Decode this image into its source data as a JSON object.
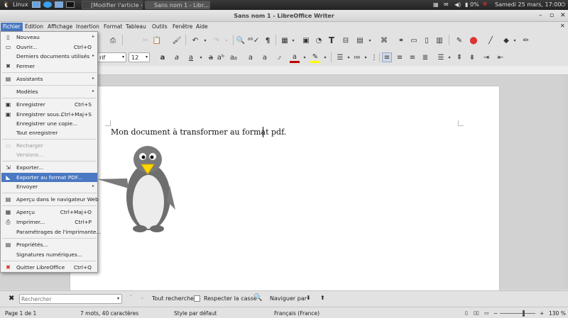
{
  "taskbar": {
    "os_label": "Linux",
    "tasks": [
      "[Modifier l'article <...",
      "Sans nom 1 - Libr..."
    ],
    "battery": "0%",
    "datetime": "Samedi 25 mars, 17:00"
  },
  "window": {
    "title": "Sans nom 1 - LibreOffice Writer"
  },
  "menubar": [
    "Fichier",
    "Édition",
    "Affichage",
    "Insertion",
    "Format",
    "Tableau",
    "Outils",
    "Fenêtre",
    "Aide"
  ],
  "format_bar": {
    "font_name": "rif",
    "font_size": "12"
  },
  "document": {
    "text": "Mon document à transformer au format pdf."
  },
  "file_menu": [
    {
      "label": "Nouveau",
      "shortcut": "",
      "submenu": true,
      "icon": "new-doc-icon",
      "disabled": false
    },
    {
      "label": "Ouvrir...",
      "shortcut": "Ctrl+O",
      "submenu": false,
      "icon": "open-folder-icon",
      "disabled": false
    },
    {
      "label": "Derniers documents utilisés",
      "shortcut": "",
      "submenu": true,
      "icon": "",
      "disabled": false
    },
    {
      "label": "Fermer",
      "shortcut": "",
      "submenu": false,
      "icon": "close-x-icon",
      "disabled": false
    },
    {
      "label": "Assistants",
      "shortcut": "",
      "submenu": true,
      "icon": "wizard-icon",
      "disabled": false
    },
    {
      "label": "Modèles",
      "shortcut": "",
      "submenu": true,
      "icon": "",
      "disabled": false
    },
    {
      "label": "Enregistrer",
      "shortcut": "Ctrl+S",
      "submenu": false,
      "icon": "save-icon",
      "disabled": false
    },
    {
      "label": "Enregistrer sous...",
      "shortcut": "Ctrl+Maj+S",
      "submenu": false,
      "icon": "save-as-icon",
      "disabled": false
    },
    {
      "label": "Enregistrer une copie...",
      "shortcut": "",
      "submenu": false,
      "icon": "",
      "disabled": false
    },
    {
      "label": "Tout enregistrer",
      "shortcut": "",
      "submenu": false,
      "icon": "",
      "disabled": false
    },
    {
      "label": "Recharger",
      "shortcut": "",
      "submenu": false,
      "icon": "reload-icon",
      "disabled": true
    },
    {
      "label": "Versions...",
      "shortcut": "",
      "submenu": false,
      "icon": "",
      "disabled": true
    },
    {
      "label": "Exporter...",
      "shortcut": "",
      "submenu": false,
      "icon": "export-icon",
      "disabled": false
    },
    {
      "label": "Exporter au format PDF...",
      "shortcut": "",
      "submenu": false,
      "icon": "pdf-icon",
      "disabled": false
    },
    {
      "label": "Envoyer",
      "shortcut": "",
      "submenu": true,
      "icon": "",
      "disabled": false
    },
    {
      "label": "Aperçu dans le navigateur Web",
      "shortcut": "",
      "submenu": false,
      "icon": "web-preview-icon",
      "disabled": false
    },
    {
      "label": "Aperçu",
      "shortcut": "Ctrl+Maj+O",
      "submenu": false,
      "icon": "print-preview-icon",
      "disabled": false
    },
    {
      "label": "Imprimer...",
      "shortcut": "Ctrl+P",
      "submenu": false,
      "icon": "print-icon",
      "disabled": false
    },
    {
      "label": "Paramétrages de l'imprimante...",
      "shortcut": "",
      "submenu": false,
      "icon": "",
      "disabled": false
    },
    {
      "label": "Propriétés...",
      "shortcut": "",
      "submenu": false,
      "icon": "properties-icon",
      "disabled": false
    },
    {
      "label": "Signatures numériques...",
      "shortcut": "",
      "submenu": false,
      "icon": "",
      "disabled": false
    },
    {
      "label": "Quitter LibreOffice",
      "shortcut": "Ctrl+Q",
      "submenu": false,
      "icon": "quit-icon",
      "disabled": false
    }
  ],
  "highlighted_menu_item": "Exporter au format PDF...",
  "findbar": {
    "placeholder": "Rechercher",
    "find_all": "Tout rechercher",
    "match_case": "Respecter la casse",
    "navigate_by": "Naviguer par"
  },
  "statusbar": {
    "page": "Page 1 de 1",
    "words": "7 mots, 40 caractères",
    "style": "Style par défaut",
    "language": "Français (France)",
    "zoom": "130 %"
  },
  "colors": {
    "menu_highlight": "#4a78c2",
    "font_color_bar": "#c00000",
    "highlight_color_bar": "#ffff00"
  }
}
